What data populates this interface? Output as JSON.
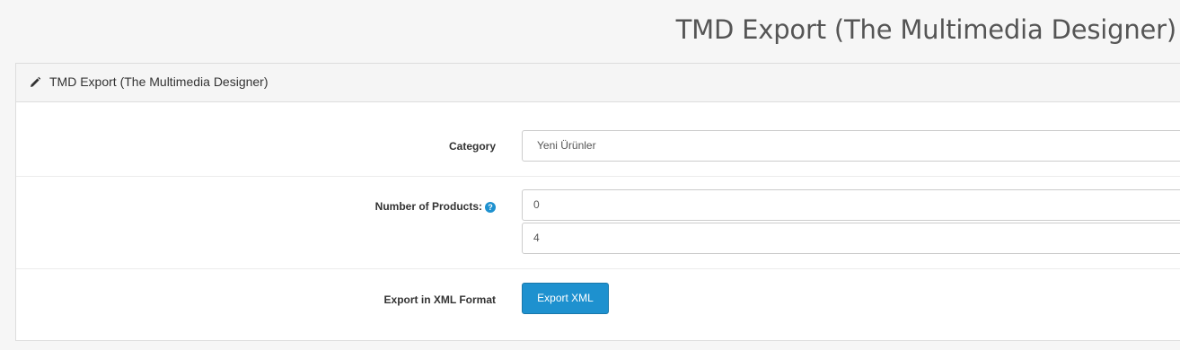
{
  "header": {
    "title": "TMD Export (The Multimedia Designer)"
  },
  "panel": {
    "heading_icon": "pencil-icon",
    "heading": "TMD Export (The Multimedia Designer)"
  },
  "form": {
    "category": {
      "label": "Category",
      "selected": "Yeni Ürünler"
    },
    "number_of_products": {
      "label": "Number of Products:",
      "help_icon": "question-circle-icon",
      "start_value": "0",
      "limit_value": "4"
    },
    "export": {
      "label": "Export in XML Format",
      "button_label": "Export XML"
    }
  },
  "colors": {
    "accent": "#1e91cf",
    "background": "#f6f6f6",
    "panel_heading": "#f5f5f5"
  }
}
